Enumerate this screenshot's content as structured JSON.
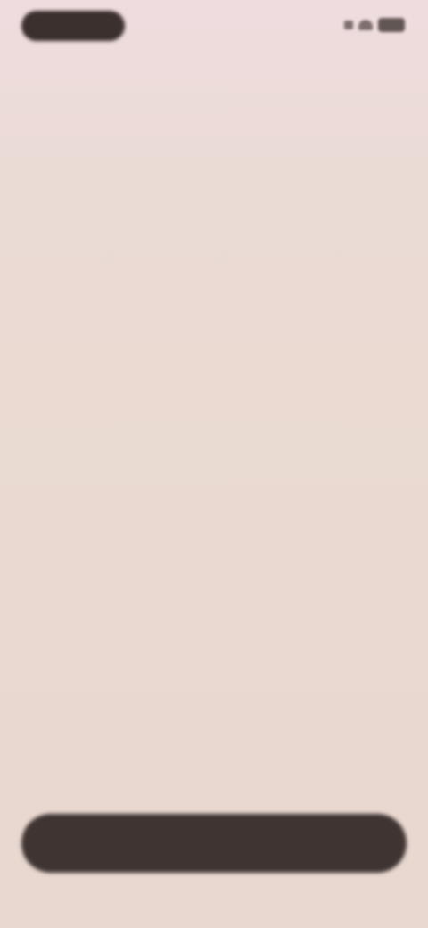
{
  "status_bar": {
    "time": "",
    "icons": [
      "signal-icon",
      "wifi-icon",
      "battery-icon"
    ]
  },
  "content": {
    "message": ""
  },
  "footer": {
    "button_label": ""
  },
  "colors": {
    "background": "#e9d9d1",
    "text": "#3d3331",
    "button": "#3f3432"
  }
}
